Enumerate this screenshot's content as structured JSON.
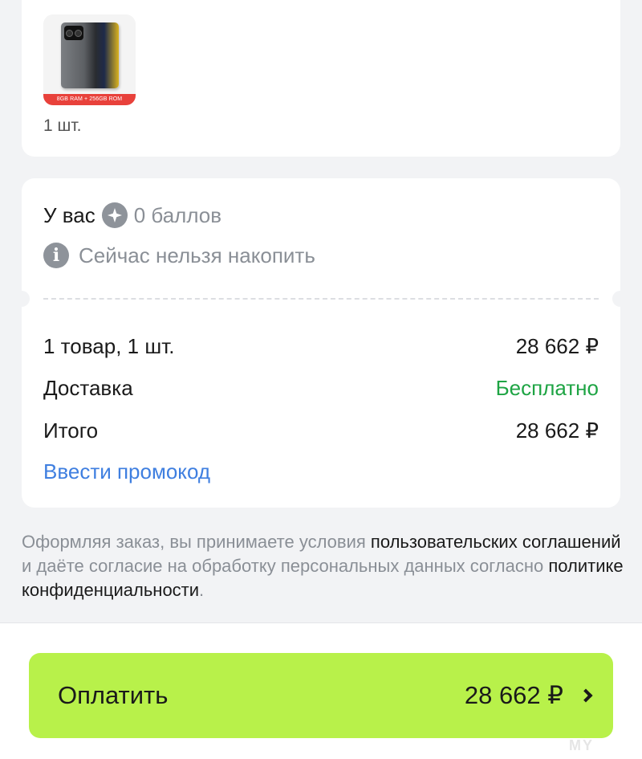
{
  "product": {
    "image_badge": "8GB RAM + 256GB ROM",
    "quantity": "1 шт."
  },
  "points": {
    "prefix": "У вас",
    "icon": "points-star-icon",
    "value": "0 баллов",
    "notice": "Сейчас нельзя накопить"
  },
  "summary": {
    "items_label": "1 товар, 1 шт.",
    "items_value": "28 662 ₽",
    "delivery_label": "Доставка",
    "delivery_value": "Бесплатно",
    "total_label": "Итого",
    "total_value": "28 662 ₽",
    "promo_link": "Ввести промокод"
  },
  "legal": {
    "part1": "Оформляя заказ, вы принимаете условия ",
    "link1": "пользовательских соглашений",
    "part2": " и даёте согласие на обработку персональных данных согласно ",
    "link2": "политике конфиденциальности",
    "part3": "."
  },
  "pay_button": {
    "label": "Оплатить",
    "amount": "28 662 ₽"
  },
  "colors": {
    "accent_green_button": "#b8f14a",
    "free_green": "#1ea444",
    "link_blue": "#3f7fe0",
    "muted_gray": "#8a8f96"
  },
  "watermark": "MY"
}
